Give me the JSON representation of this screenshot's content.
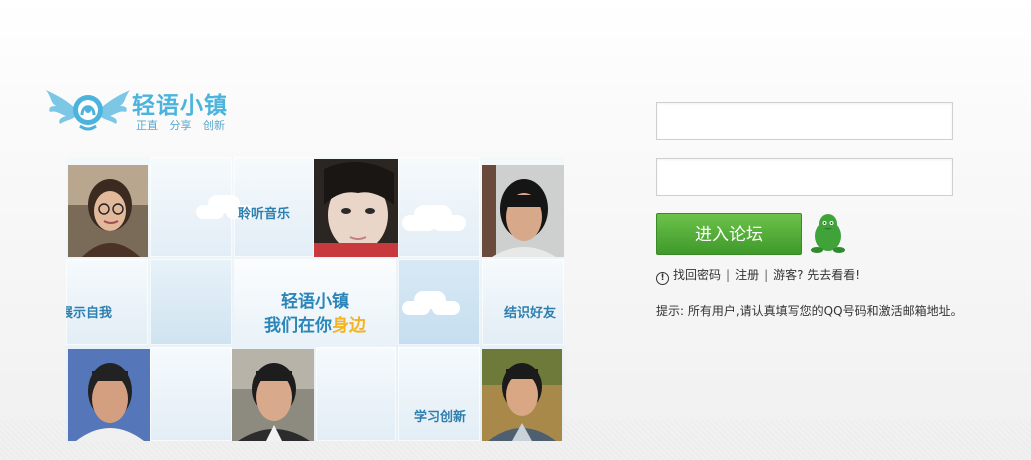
{
  "logo": {
    "title": "轻语小镇",
    "slogan": "正直 分享 创新",
    "icon": "winged-circle-logo"
  },
  "banner": {
    "labels": {
      "music": "聆听音乐",
      "show": "展示自我",
      "friends": "结识好友",
      "learn": "学习创新"
    },
    "center": {
      "line1": "轻语小镇",
      "line2_prefix": "我们在你",
      "line2_highlight": "身边"
    },
    "photos": [
      "portrait-woman-glasses",
      "portrait-girl-closeup",
      "portrait-young-man-1",
      "portrait-young-man-2",
      "portrait-young-man-3",
      "portrait-young-man-4"
    ]
  },
  "login": {
    "username_placeholder": "",
    "password_placeholder": "",
    "submit_label": "进入论坛",
    "qq_icon": "qq-penguin-icon"
  },
  "links": {
    "forgot": "找回密码",
    "register": "注册",
    "guest": "游客? 先去看看!"
  },
  "hint": "提示: 所有用户,请认真填写您的QQ号码和激活邮箱地址。",
  "colors": {
    "brand_blue": "#4cb4dc",
    "button_green": "#4fa935",
    "highlight_yellow": "#f4b321"
  }
}
